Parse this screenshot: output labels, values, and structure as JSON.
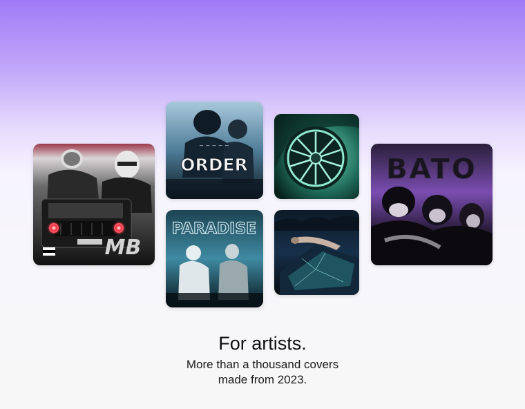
{
  "covers": [
    {
      "id": "mb",
      "art_text": "MB",
      "theme": "black-and-white with red lights"
    },
    {
      "id": "order",
      "art_text": "ORDER",
      "theme": "blue monochrome"
    },
    {
      "id": "wheel",
      "art_text": "",
      "theme": "green car wheel"
    },
    {
      "id": "paradise",
      "art_text": "PARADISE",
      "theme": "dark teal"
    },
    {
      "id": "crash",
      "art_text": "",
      "theme": "dark blue crash"
    },
    {
      "id": "bato",
      "art_text": "BATO",
      "theme": "purple"
    }
  ],
  "headline": "For artists.",
  "subtitle_line1": "More than a thousand covers",
  "subtitle_line2": "made from 2023."
}
